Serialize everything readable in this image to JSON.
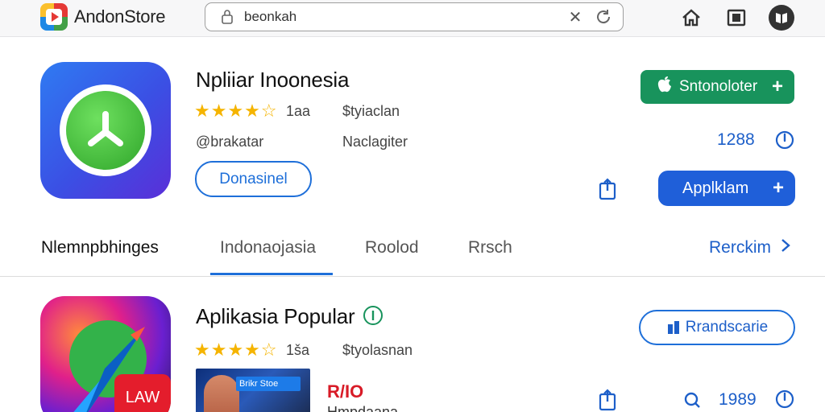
{
  "topbar": {
    "brand_name": "AndonStore",
    "search": {
      "query": "beonkah"
    },
    "icons": [
      "home-icon",
      "gallery-icon",
      "book-icon"
    ]
  },
  "app1": {
    "title": "Npliiar Inoonesia",
    "rating_text": "★★★★☆",
    "rating_value": "1aa",
    "category": "$tyiaclan",
    "developer": "@brakatar",
    "tag": "Naclagiter",
    "outline_button": "Donasinel",
    "green_button": "Sntonoloter",
    "count": "1288",
    "blue_button": "Applklam"
  },
  "tabs": {
    "items": [
      "Nlemnpbhinges",
      "Indonaojasia",
      "Roolod",
      "Rrsch"
    ],
    "more": "Rerckim"
  },
  "app2": {
    "title": "Aplikasia Popular",
    "icon_badge": "LAW",
    "rating_text": "★★★★☆",
    "rating_value": "1ša",
    "category": "$tyolasnan",
    "outline_button": "Rrandscarie",
    "thumbnail_label": "Brikr Stoe",
    "price": "R/IO",
    "subtext": "Hmpdaana",
    "count": "1989"
  },
  "colors": {
    "accent_blue": "#1e6fd9",
    "green": "#18935c",
    "star": "#f5b400",
    "price_red": "#d81b27"
  }
}
